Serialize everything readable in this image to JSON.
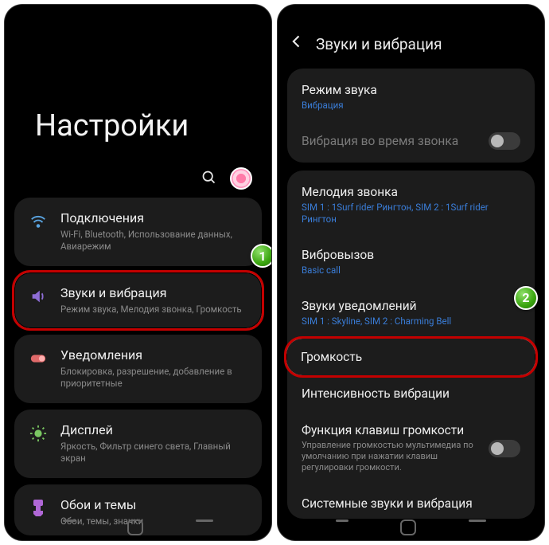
{
  "left": {
    "bigTitle": "Настройки",
    "items": [
      {
        "icon": "wifi-icon",
        "color": "#5aa4e0",
        "title": "Подключения",
        "sub": "Wi-Fi, Bluetooth, Использование данных, Авиарежим"
      },
      {
        "icon": "sound-icon",
        "color": "#8e6dd6",
        "title": "Звуки и вибрация",
        "sub": "Режим звука, Мелодия звонка, Громкость"
      },
      {
        "icon": "notification-icon",
        "color": "#e06a6a",
        "title": "Уведомления",
        "sub": "Блокировка, разрешение, добавление в приоритетные"
      },
      {
        "icon": "display-icon",
        "color": "#7bc862",
        "title": "Дисплей",
        "sub": "Яркость, Фильтр синего света, Главный экран"
      },
      {
        "icon": "wallpaper-icon",
        "color": "#b067d6",
        "title": "Обои и темы",
        "sub": "Обои, темы, значки"
      }
    ],
    "badge1": "1"
  },
  "right": {
    "header": "Звуки и вибрация",
    "panel1": [
      {
        "title": "Режим звука",
        "sub": "Вибрация",
        "subColor": "link"
      },
      {
        "title": "Вибрация во время звонка",
        "dim": true,
        "toggle": true
      }
    ],
    "panel2": [
      {
        "title": "Мелодия звонка",
        "sub": "SIM 1 : 1Surf rider Рингтон, SIM 2 : 1Surf rider Рингтон",
        "subColor": "link"
      },
      {
        "title": "Вибровызов",
        "sub": "Basic call",
        "subColor": "link"
      },
      {
        "title": "Звуки уведомлений",
        "sub": "SIM 1 : Skyline, SIM 2 : Charming Bell",
        "subColor": "link"
      },
      {
        "title": "Громкость",
        "highlight": true
      },
      {
        "title": "Интенсивность вибрации"
      },
      {
        "title": "Функция клавиш громкости",
        "desc": "Управление громкостью мультимедиа по умолчанию при нажатии клавиш регулировки громкости.",
        "toggle": true
      },
      {
        "title": "Системные звуки и вибрация"
      }
    ],
    "badge2": "2"
  }
}
